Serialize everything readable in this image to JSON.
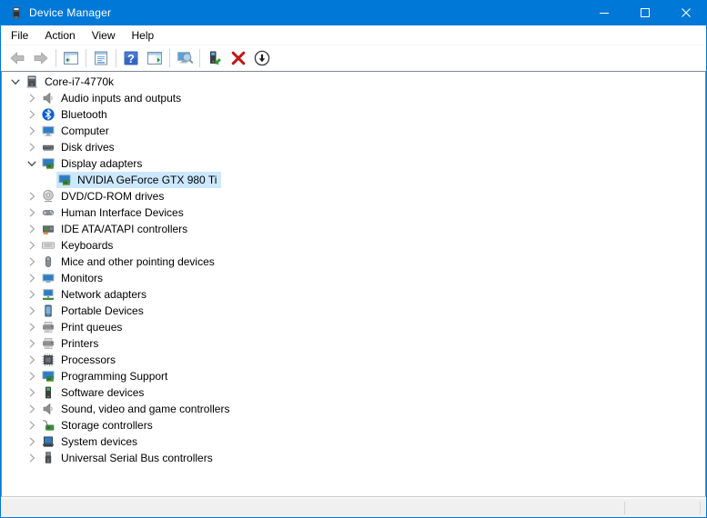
{
  "window": {
    "title": "Device Manager",
    "accent_color": "#0078d7",
    "icon": "device-manager-icon",
    "controls": [
      {
        "name": "minimize",
        "icon": "minimize-icon"
      },
      {
        "name": "maximize",
        "icon": "maximize-icon"
      },
      {
        "name": "close",
        "icon": "close-icon"
      }
    ]
  },
  "menubar": {
    "items": [
      "File",
      "Action",
      "View",
      "Help"
    ]
  },
  "toolbar": {
    "buttons": [
      {
        "name": "back",
        "icon": "back-arrow-icon",
        "disabled": true
      },
      {
        "name": "forward",
        "icon": "forward-arrow-icon",
        "disabled": true
      },
      {
        "separator": true
      },
      {
        "name": "show-console-tree",
        "icon": "console-tree-icon"
      },
      {
        "separator": true
      },
      {
        "name": "properties",
        "icon": "properties-icon"
      },
      {
        "separator": true
      },
      {
        "name": "help",
        "icon": "help-icon"
      },
      {
        "name": "show-action-pane",
        "icon": "action-pane-icon"
      },
      {
        "separator": true
      },
      {
        "name": "scan-for-hardware-changes",
        "icon": "scan-icon"
      },
      {
        "separator": true
      },
      {
        "name": "update-driver",
        "icon": "update-driver-icon"
      },
      {
        "name": "uninstall-device",
        "icon": "uninstall-icon"
      },
      {
        "name": "disable-device",
        "icon": "disable-icon"
      }
    ]
  },
  "tree": {
    "selection_color": "#cce8ff",
    "items": [
      {
        "label": "Core-i7-4770k",
        "icon": "computer-tower-icon",
        "level": 0,
        "state": "expanded",
        "selected": false
      },
      {
        "label": "Audio inputs and outputs",
        "icon": "speaker-icon",
        "level": 1,
        "state": "collapsed",
        "selected": false
      },
      {
        "label": "Bluetooth",
        "icon": "bluetooth-icon",
        "level": 1,
        "state": "collapsed",
        "selected": false
      },
      {
        "label": "Computer",
        "icon": "computer-icon",
        "level": 1,
        "state": "collapsed",
        "selected": false
      },
      {
        "label": "Disk drives",
        "icon": "disk-drive-icon",
        "level": 1,
        "state": "collapsed",
        "selected": false
      },
      {
        "label": "Display adapters",
        "icon": "display-adapter-icon",
        "level": 1,
        "state": "expanded",
        "selected": false
      },
      {
        "label": "NVIDIA GeForce GTX 980 Ti",
        "icon": "display-adapter-icon",
        "level": 2,
        "state": "leaf",
        "selected": true
      },
      {
        "label": "DVD/CD-ROM drives",
        "icon": "dvd-drive-icon",
        "level": 1,
        "state": "collapsed",
        "selected": false
      },
      {
        "label": "Human Interface Devices",
        "icon": "gamepad-icon",
        "level": 1,
        "state": "collapsed",
        "selected": false
      },
      {
        "label": "IDE ATA/ATAPI controllers",
        "icon": "ide-controller-icon",
        "level": 1,
        "state": "collapsed",
        "selected": false
      },
      {
        "label": "Keyboards",
        "icon": "keyboard-icon",
        "level": 1,
        "state": "collapsed",
        "selected": false
      },
      {
        "label": "Mice and other pointing devices",
        "icon": "mouse-icon",
        "level": 1,
        "state": "collapsed",
        "selected": false
      },
      {
        "label": "Monitors",
        "icon": "monitor-icon",
        "level": 1,
        "state": "collapsed",
        "selected": false
      },
      {
        "label": "Network adapters",
        "icon": "network-adapter-icon",
        "level": 1,
        "state": "collapsed",
        "selected": false
      },
      {
        "label": "Portable Devices",
        "icon": "portable-device-icon",
        "level": 1,
        "state": "collapsed",
        "selected": false
      },
      {
        "label": "Print queues",
        "icon": "printer-icon",
        "level": 1,
        "state": "collapsed",
        "selected": false
      },
      {
        "label": "Printers",
        "icon": "printer-icon",
        "level": 1,
        "state": "collapsed",
        "selected": false
      },
      {
        "label": "Processors",
        "icon": "processor-icon",
        "level": 1,
        "state": "collapsed",
        "selected": false
      },
      {
        "label": "Programming Support",
        "icon": "display-adapter-icon",
        "level": 1,
        "state": "collapsed",
        "selected": false
      },
      {
        "label": "Software devices",
        "icon": "software-device-icon",
        "level": 1,
        "state": "collapsed",
        "selected": false
      },
      {
        "label": "Sound, video and game controllers",
        "icon": "speaker-icon",
        "level": 1,
        "state": "collapsed",
        "selected": false
      },
      {
        "label": "Storage controllers",
        "icon": "storage-controller-icon",
        "level": 1,
        "state": "collapsed",
        "selected": false
      },
      {
        "label": "System devices",
        "icon": "system-device-icon",
        "level": 1,
        "state": "collapsed",
        "selected": false
      },
      {
        "label": "Universal Serial Bus controllers",
        "icon": "usb-icon",
        "level": 1,
        "state": "collapsed",
        "selected": false
      }
    ]
  },
  "statusbar": {
    "text": ""
  }
}
